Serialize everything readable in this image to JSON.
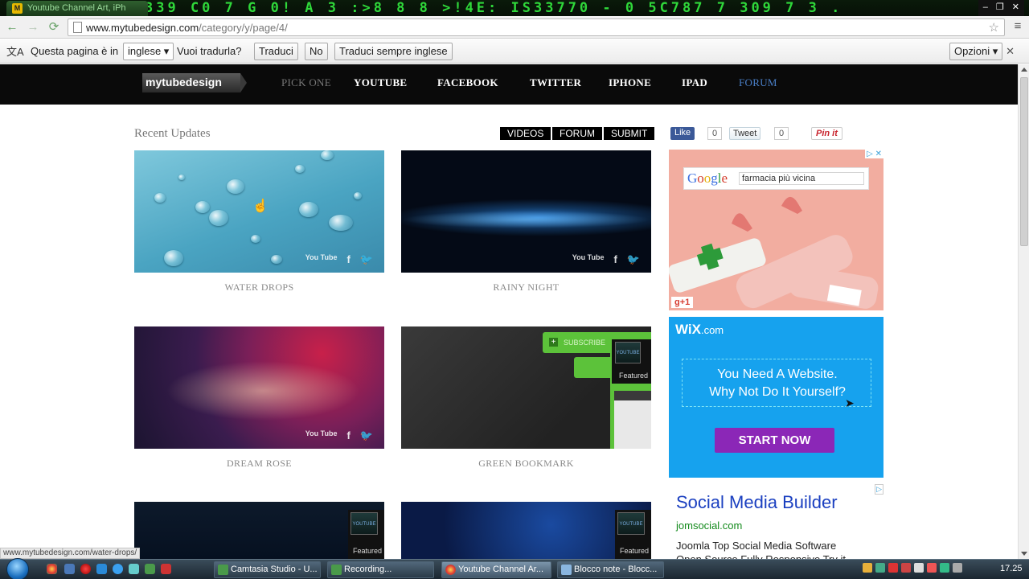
{
  "browser": {
    "tab_title": "Youtube Channel Art, iPh",
    "tab_favicon": "M",
    "matrix_text": "339 C0 7 G 0! A  3 :>8 8 8  >!4E:  IS33770  -  0  5C787 7  309  7  3 .",
    "window_controls": [
      "–",
      "❐",
      "✕"
    ],
    "back_icon": "←",
    "forward_icon": "→",
    "reload_icon": "⟳",
    "url_host": "www.mytubedesign.com",
    "url_path": "/category/y/page/4/",
    "star_icon": "☆",
    "menu_icon": "≡",
    "status_url": "www.mytubedesign.com/water-drops/"
  },
  "translate_bar": {
    "icon_text": "文A",
    "prompt_prefix": "Questa pagina è in",
    "language": "inglese ▾",
    "prompt_suffix": "Vuoi tradurla?",
    "translate": "Traduci",
    "no": "No",
    "always": "Traduci sempre inglese",
    "options": "Opzioni ▾",
    "close": "✕"
  },
  "site": {
    "logo": "mytubedesign",
    "nav": [
      "PICK ONE",
      "YOUTUBE",
      "FACEBOOK",
      "TWITTER",
      "IPHONE",
      "IPAD",
      "FORUM"
    ],
    "section_title": "Recent Updates",
    "pills": [
      "VIDEOS",
      "FORUM",
      "SUBMIT"
    ],
    "share": {
      "like": "Like",
      "like_count": "0",
      "tweet": "Tweet",
      "tweet_count": "0",
      "pin": "Pin it"
    },
    "tiles": [
      {
        "caption": "WATER DROPS"
      },
      {
        "caption": "RAINY NIGHT"
      },
      {
        "caption": "DREAM ROSE"
      },
      {
        "caption": "GREEN BOOKMARK",
        "subscribe": "SUBSCRIBE",
        "featured": "Featured",
        "badge": "YOUTUBE"
      },
      {
        "featured": "Featured",
        "badge": "YOUTUBE"
      },
      {
        "featured": "Featured",
        "badge": "YOUTUBE"
      }
    ],
    "tile_social": {
      "youtube": "You Tube",
      "facebook": "f",
      "twitter": "🐦"
    }
  },
  "ads": {
    "google": {
      "close": "▷ ✕",
      "logo_letters": [
        "G",
        "o",
        "o",
        "g",
        "l",
        "e"
      ],
      "query": "farmacia più vicina",
      "gplus": "g+1"
    },
    "wix": {
      "logo": "WiX",
      "logo_suffix": ".com",
      "line1": "You Need A Website.",
      "line2": "Why Not Do It Yourself?",
      "cta": "START NOW"
    },
    "text_ad": {
      "badge": "▷",
      "title": "Social Media Builder",
      "url": "jomsocial.com",
      "desc1": "Joomla Top Social Media Software",
      "desc2": "Open Source Fully Responsive Try it"
    }
  },
  "taskbar": {
    "tasks": [
      {
        "label": "Camtasia Studio - U...",
        "active": false
      },
      {
        "label": "Recording...",
        "active": false
      },
      {
        "label": "Youtube Channel Ar...",
        "active": true
      },
      {
        "label": "Blocco note - Blocc...",
        "active": false
      }
    ],
    "clock": "17.25"
  },
  "colors": {
    "nav_bg": "#0a0a0a",
    "forum_link": "#4a7fc7",
    "wix_bg": "#16a2ee",
    "wix_cta": "#8b27b7",
    "ad_title": "#1a3fc0",
    "ad_url": "#138a1c"
  }
}
